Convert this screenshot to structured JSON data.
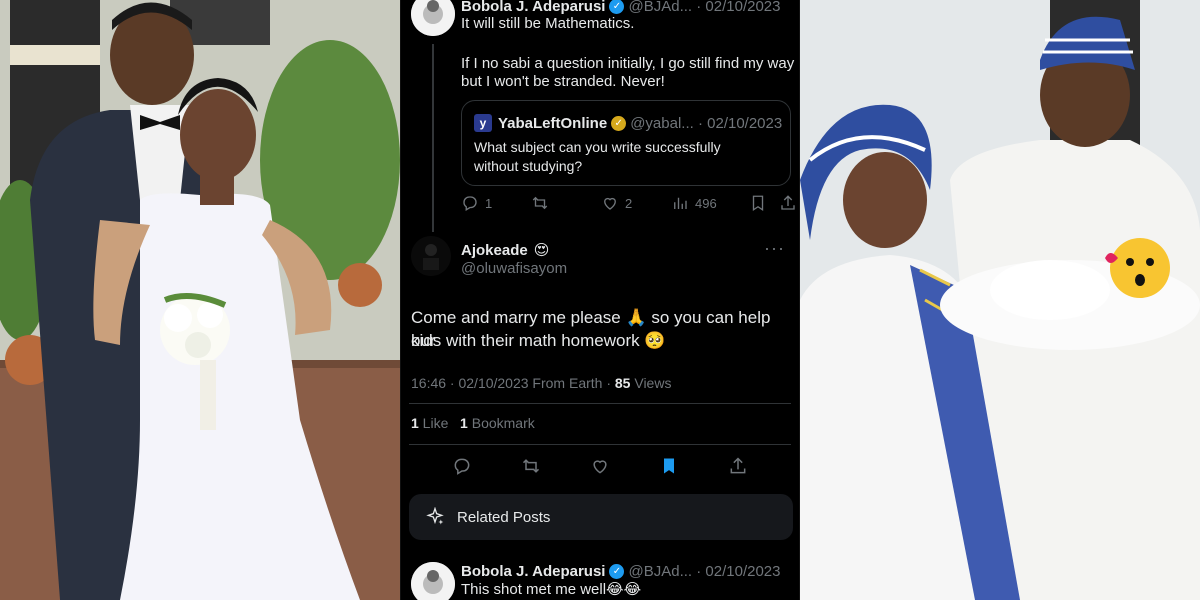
{
  "tweet_main": {
    "author_name": "Bobola J. Adeparusi",
    "author_handle": "@BJAd...",
    "date": "02/10/2023",
    "line1": "It will still be Mathematics.",
    "line2": "If I no sabi a question initially, I go still find my way",
    "line3": "but I won't be stranded. Never!",
    "quote": {
      "author_name": "YabaLeftOnline",
      "author_handle": "@yabal...",
      "date": "02/10/2023",
      "logo_letter": "y",
      "text1": "What subject can you write successfully",
      "text2": "without studying?"
    },
    "replies": "1",
    "likes": "2",
    "views": "496"
  },
  "reply_post": {
    "author_name": "Ajokeade",
    "author_emoji": "😍",
    "author_handle": "@oluwafisayom",
    "text1": "Come and marry me please 🙏 so you can help our",
    "text2": "kids with their math homework 🥺",
    "meta_time": "16:46 · 02/10/2023 From Earth · ",
    "meta_views_count": "85",
    "meta_views_label": " Views",
    "likes_count": "1",
    "likes_label": " Like",
    "bookmarks_count": "1",
    "bookmarks_label": "Bookmark"
  },
  "related_posts_label": "Related Posts",
  "tweet_bottom": {
    "author_name": "Bobola J. Adeparusi",
    "author_handle": "@BJAd...",
    "date": "02/10/2023",
    "text": "This shot met me well😂😂"
  },
  "colors": {
    "background": "#000000",
    "text": "#e7e9ea",
    "muted": "#71767b",
    "verified_blue": "#1d9bf0",
    "verified_gold": "#d6a91c",
    "bookmark_active": "#1d9bf0",
    "divider": "#2f3336"
  },
  "icons": [
    "reply-icon",
    "retweet-icon",
    "like-icon",
    "views-icon",
    "bookmark-icon",
    "share-icon",
    "sparkle-icon",
    "more-icon",
    "verified-icon"
  ]
}
